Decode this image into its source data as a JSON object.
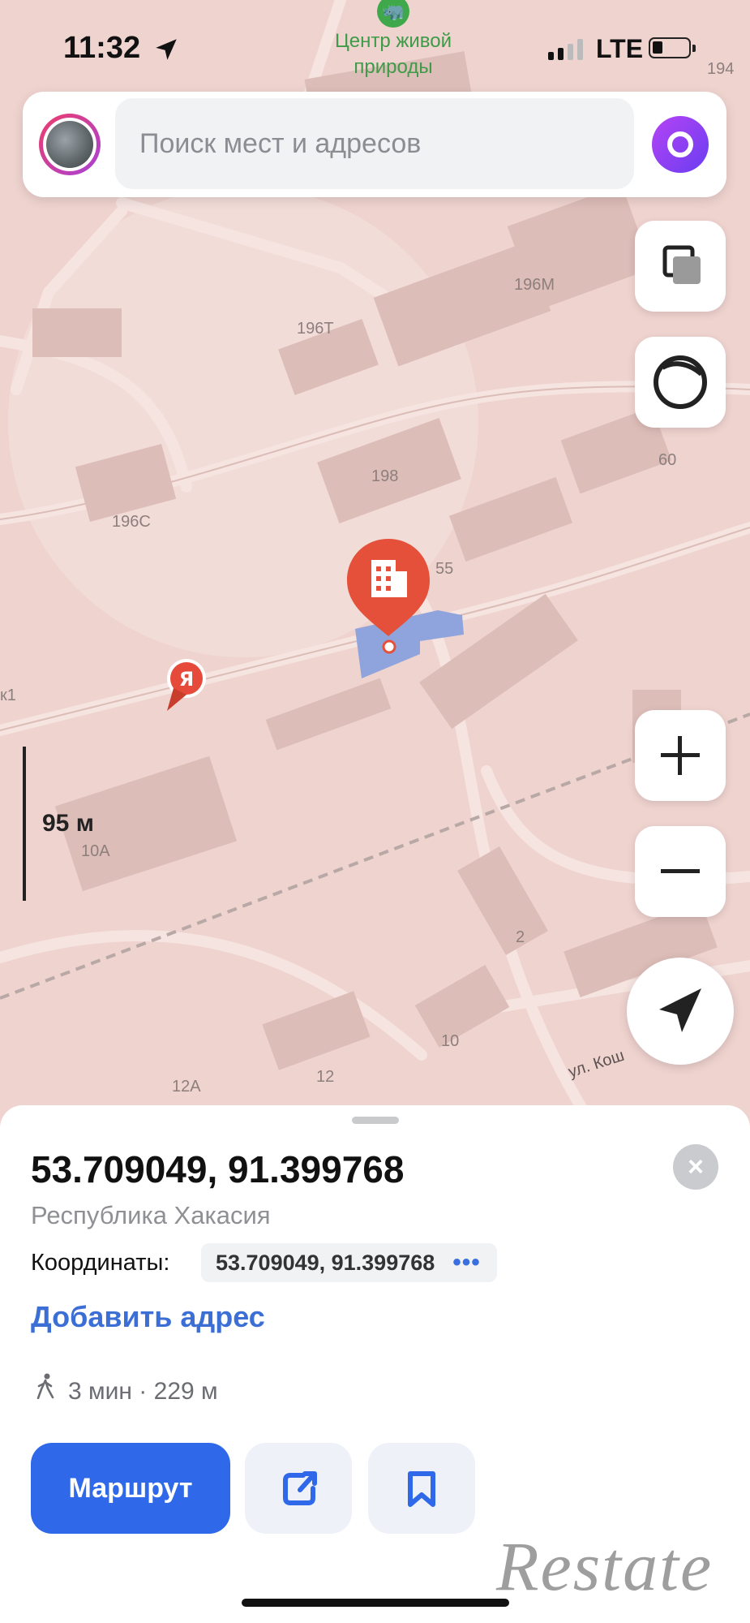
{
  "status_bar": {
    "time": "11:32",
    "network": "LTE",
    "poi_name_line1": "Центр живой",
    "poi_name_line2": "природы",
    "building_194": "194"
  },
  "search": {
    "placeholder": "Поиск мест и адресов"
  },
  "map": {
    "labels": [
      "196М",
      "196Т",
      "198",
      "196С",
      "60",
      "55",
      "10А",
      "2",
      "10",
      "12",
      "12А",
      "к1"
    ],
    "street": "ул. Кош",
    "scale": "95 м"
  },
  "place": {
    "title": "53.709049, 91.399768",
    "region": "Республика Хакасия",
    "coords_label": "Координаты:",
    "coords_value": "53.709049, 91.399768",
    "add_address": "Добавить адрес",
    "walk_info": "3 мин · 229 м",
    "route_label": "Маршрут"
  },
  "watermark": "Restate",
  "colors": {
    "accent": "#2f69ea",
    "link": "#3c6fd6",
    "pin": "#e5503a",
    "map_bg": "#efd3cf"
  },
  "icons": [
    "location-arrow-icon",
    "signal-icon",
    "battery-icon",
    "alice-icon",
    "layers-icon",
    "map-style-icon",
    "zoom-in-icon",
    "zoom-out-icon",
    "navigate-icon",
    "building-pin-icon",
    "yandex-pin-icon",
    "close-icon",
    "walk-icon",
    "share-icon",
    "bookmark-icon"
  ]
}
